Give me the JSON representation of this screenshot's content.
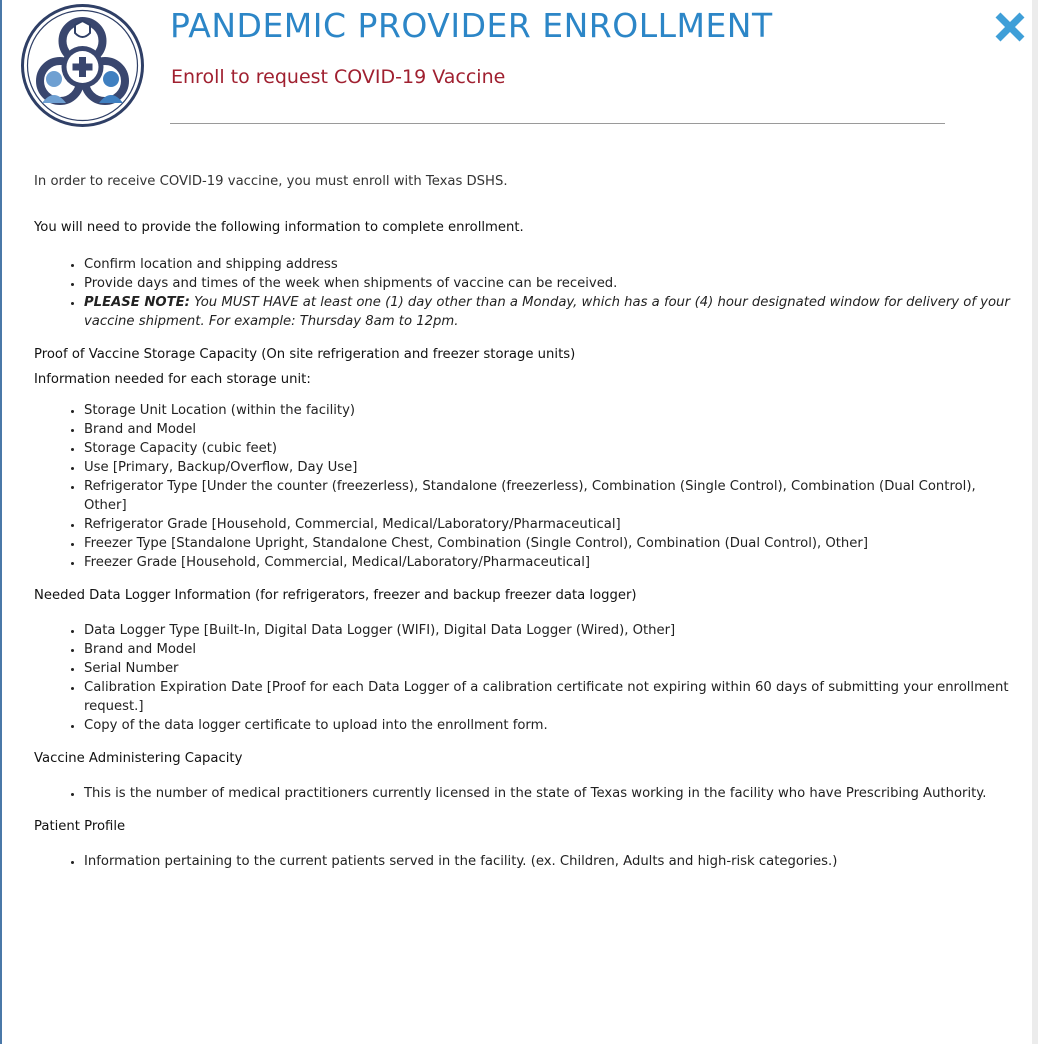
{
  "header": {
    "title": "PANDEMIC PROVIDER ENROLLMENT",
    "subtitle": "Enroll to request COVID-19 Vaccine",
    "close_icon": "close-x-icon",
    "logo_icon": "biohazard-medical-logo"
  },
  "colors": {
    "title": "#2c86c7",
    "subtitle": "#a02030",
    "close": "#3f9fd8"
  },
  "intro": "In order to receive COVID-19 vaccine, you must enroll with Texas DSHS.",
  "requirements": {
    "heading": "You will need to provide the following information to complete enrollment.",
    "items": [
      "Confirm location and shipping address",
      "Provide days and times of the week when shipments of vaccine can be received."
    ],
    "note_label": "PLEASE NOTE:",
    "note_text": " You MUST HAVE at least one (1) day other than a Monday, which has a four (4) hour designated window for delivery of your vaccine shipment. For example: Thursday 8am to 12pm."
  },
  "storage": {
    "heading": "Proof of Vaccine Storage Capacity (On site refrigeration and freezer storage units)",
    "subheading": "Information needed for each storage unit:",
    "items": [
      "Storage Unit Location (within the facility)",
      "Brand and Model",
      "Storage Capacity (cubic feet)",
      "Use [Primary, Backup/Overflow, Day Use]",
      "Refrigerator Type [Under the counter (freezerless), Standalone (freezerless), Combination (Single Control), Combination (Dual Control), Other]",
      "Refrigerator Grade [Household, Commercial, Medical/Laboratory/Pharmaceutical]",
      "Freezer Type [Standalone Upright, Standalone Chest, Combination (Single Control), Combination (Dual Control), Other]",
      "Freezer Grade [Household, Commercial, Medical/Laboratory/Pharmaceutical]"
    ]
  },
  "data_logger": {
    "heading": "Needed Data Logger Information (for refrigerators, freezer and backup freezer data logger)",
    "items": [
      "Data Logger Type [Built-In, Digital Data Logger (WIFI), Digital Data Logger (Wired), Other]",
      "Brand and Model",
      "Serial Number",
      "Calibration Expiration Date [Proof for each Data Logger of a calibration certificate not expiring within 60 days of submitting your enrollment request.]",
      "Copy of the data logger certificate to upload into the enrollment form."
    ]
  },
  "administering": {
    "heading": "Vaccine Administering Capacity",
    "items": [
      "This is the number of medical practitioners currently licensed in the state of Texas working in the facility who have Prescribing Authority."
    ]
  },
  "patient_profile": {
    "heading": "Patient Profile",
    "items": [
      "Information pertaining to the current patients served in the facility. (ex. Children, Adults and high-risk categories.)"
    ]
  }
}
